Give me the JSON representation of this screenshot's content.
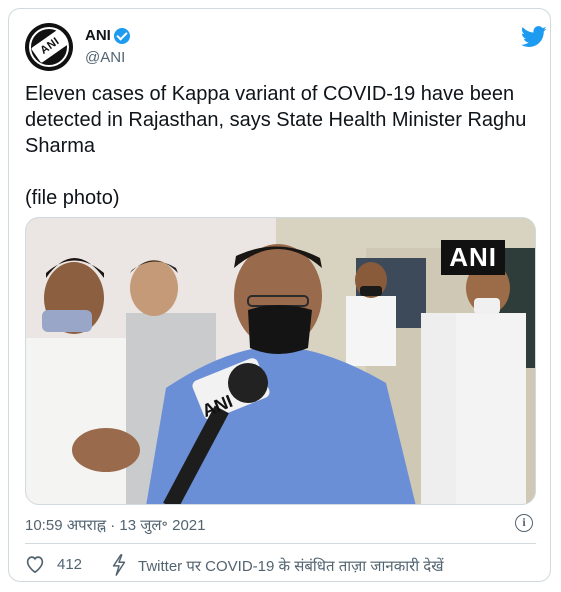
{
  "account": {
    "name": "ANI",
    "handle": "@ANI",
    "logo_text": "ANI"
  },
  "tweet": {
    "text": "Eleven cases of Kappa variant of COVID-19 have been detected in Rajasthan, says State Health Minister Raghu Sharma\n\n(file photo)"
  },
  "media": {
    "watermark": "ANI",
    "mic_label": "ANI"
  },
  "meta": {
    "time": "10:59 अपराह्न",
    "separator": "·",
    "date": "13 जुल॰ 2021"
  },
  "actions": {
    "like_count": "412",
    "covid_info_link": "Twitter पर COVID-19 के संबंधित ताज़ा जानकारी देखें"
  },
  "colors": {
    "accent": "#1d9bf0",
    "muted": "#536471",
    "border": "#cfd9de"
  },
  "icons": [
    "verified-badge-icon",
    "twitter-bird-icon",
    "info-icon",
    "heart-icon",
    "lightning-bolt-icon"
  ]
}
